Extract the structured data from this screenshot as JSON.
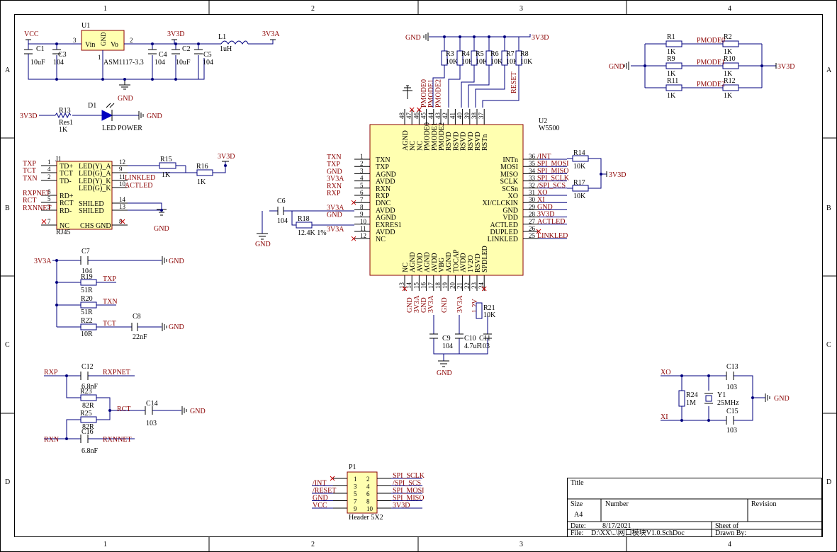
{
  "frame": {
    "cols": [
      "1",
      "2",
      "3",
      "4"
    ],
    "rows": [
      "A",
      "B",
      "C",
      "D"
    ]
  },
  "title_block": {
    "title_label": "Title",
    "size_label": "Size",
    "size_value": "A4",
    "number_label": "Number",
    "revision_label": "Revision",
    "date_label": "Date:",
    "date_value": "8/17/2021",
    "sheet_label": "Sheet  of",
    "file_label": "File:",
    "file_value": "D:\\XX\\..\\网口模块V1.0.SchDoc",
    "drawn_label": "Drawn By:"
  },
  "power": {
    "vcc": "VCC",
    "v33d": "3V3D",
    "v33a": "3V3A",
    "gnd": "GND"
  },
  "regulator": {
    "ref": "U1",
    "part": "ASM1117-3.3",
    "pin_vin": "Vin",
    "pin_vo": "Vo",
    "pin_gnd": "GND",
    "pin3": "3",
    "pin2": "2",
    "pin1": "1",
    "c1": "C1",
    "c1v": "10uF",
    "c3": "C3",
    "c3v": "104",
    "c4": "C4",
    "c4v": "104",
    "c2": "C2",
    "c2v": "10uF",
    "c5": "C5",
    "c5v": "104",
    "l1": "L1",
    "l1v": "1uH"
  },
  "led_circuit": {
    "r13": "R13",
    "r13v": "Res1",
    "r13k": "1K",
    "d1": "D1",
    "d1v": "LED  POWER"
  },
  "rj45": {
    "ref": "J1",
    "part": "RJ45",
    "left_pins": [
      {
        "num": "1",
        "name": "TD+",
        "net": "TXP"
      },
      {
        "num": "4",
        "name": "TCT",
        "net": "TCT"
      },
      {
        "num": "2",
        "name": "TD-",
        "net": "TXN"
      },
      {
        "num": "6",
        "name": "RD+",
        "net": "RXPNET"
      },
      {
        "num": "5",
        "name": "RCT",
        "net": "RCT"
      },
      {
        "num": "3",
        "name": "RD-",
        "net": "RXNNET"
      },
      {
        "num": "7",
        "name": "NC",
        "net": ""
      }
    ],
    "right_pins": [
      {
        "num": "12",
        "name": "LED(Y)_A"
      },
      {
        "num": "9",
        "name": "LED(G)_A"
      },
      {
        "num": "11",
        "name": "LED(Y)_K"
      },
      {
        "num": "10",
        "name": "LED(G)_K"
      },
      {
        "num": "14",
        "name": "SHILED"
      },
      {
        "num": "13",
        "name": "SHILED"
      },
      {
        "num": "8",
        "name": "CHS GND"
      }
    ],
    "r15": "R15",
    "r15v": "1K",
    "r16": "R16",
    "r16v": "1K",
    "linkled": "LINKLED",
    "actled": "ACTLED"
  },
  "w5500": {
    "ref": "U2",
    "part": "W5500",
    "left_pins": [
      {
        "num": "1",
        "name": "TXN",
        "net": "TXN"
      },
      {
        "num": "2",
        "name": "TXP",
        "net": "TXP"
      },
      {
        "num": "3",
        "name": "AGND",
        "net": "GND"
      },
      {
        "num": "4",
        "name": "AVDD",
        "net": "3V3A"
      },
      {
        "num": "5",
        "name": "RXN",
        "net": "RXN"
      },
      {
        "num": "6",
        "name": "RXP",
        "net": "RXP"
      },
      {
        "num": "7",
        "name": "DNC",
        "net": ""
      },
      {
        "num": "8",
        "name": "AVDD",
        "net": "3V3A"
      },
      {
        "num": "9",
        "name": "AGND",
        "net": "GND"
      },
      {
        "num": "10",
        "name": "EXRES1",
        "net": ""
      },
      {
        "num": "11",
        "name": "AVDD",
        "net": "3V3A"
      },
      {
        "num": "12",
        "name": "NC",
        "net": ""
      }
    ],
    "right_pins": [
      {
        "num": "36",
        "name": "INTn",
        "net": "/INT"
      },
      {
        "num": "35",
        "name": "MOSI",
        "net": "SPI_MOSI"
      },
      {
        "num": "34",
        "name": "MISO",
        "net": "SPI_MISO"
      },
      {
        "num": "33",
        "name": "SCLK",
        "net": "SPI_SCLK"
      },
      {
        "num": "32",
        "name": "SCSn",
        "net": "/SPI_SCS"
      },
      {
        "num": "31",
        "name": "XO",
        "net": "XO"
      },
      {
        "num": "30",
        "name": "XI/CLCKIN",
        "net": "XI"
      },
      {
        "num": "29",
        "name": "GND",
        "net": "GND"
      },
      {
        "num": "28",
        "name": "VDD",
        "net": "3V3D"
      },
      {
        "num": "27",
        "name": "ACTLED",
        "net": "ACTLED"
      },
      {
        "num": "26",
        "name": "DUPLED",
        "net": ""
      },
      {
        "num": "25",
        "name": "LINKLED",
        "net": "LINKLED"
      }
    ],
    "top_pins": [
      {
        "num": "48",
        "name": "AGND"
      },
      {
        "num": "47",
        "name": "NC"
      },
      {
        "num": "46",
        "name": "NC"
      },
      {
        "num": "45",
        "name": "PMODE0"
      },
      {
        "num": "44",
        "name": "PMODE1"
      },
      {
        "num": "43",
        "name": "PMODE2"
      },
      {
        "num": "42",
        "name": "RSVD"
      },
      {
        "num": "41",
        "name": "RSVD"
      },
      {
        "num": "40",
        "name": "RSVD"
      },
      {
        "num": "39",
        "name": "RSVD"
      },
      {
        "num": "38",
        "name": "RSVD"
      },
      {
        "num": "37",
        "name": "RSTn"
      }
    ],
    "top_nets": [
      "PMODE0",
      "PMODE1",
      "PMODE2"
    ],
    "bottom_pins": [
      {
        "num": "13",
        "name": "NC"
      },
      {
        "num": "14",
        "name": "AGND"
      },
      {
        "num": "15",
        "name": "AVDD"
      },
      {
        "num": "16",
        "name": "AGND"
      },
      {
        "num": "17",
        "name": "AVDD"
      },
      {
        "num": "18",
        "name": "VBG"
      },
      {
        "num": "19",
        "name": "AGND"
      },
      {
        "num": "20",
        "name": "TOCAP"
      },
      {
        "num": "21",
        "name": "AVDD"
      },
      {
        "num": "22",
        "name": "1V2O"
      },
      {
        "num": "23",
        "name": "RSVD"
      },
      {
        "num": "24",
        "name": "SPDLED"
      }
    ],
    "bottom_nets": [
      "GND",
      "3V3A",
      "GND",
      "3V3A",
      "GND",
      "3V3A",
      "1.2V"
    ],
    "reset_net": "RESET",
    "pullups": [
      "R3",
      "R4",
      "R5",
      "R6",
      "R7",
      "R8"
    ],
    "pullup_val": "10K",
    "c6": "C6",
    "c6v": "104",
    "r18": "R18",
    "r18v": "12.4K 1%",
    "r21": "R21",
    "r21v": "10K",
    "c9": "C9",
    "c9v": "104",
    "c10": "C10",
    "c10v": "4.7uF",
    "c11": "C11",
    "c11v": "103",
    "r14": "R14",
    "r14v": "10K",
    "r17": "R17",
    "r17v": "10K"
  },
  "pmode": {
    "rows": [
      {
        "ra": "R1",
        "rav": "1K",
        "net": "PMODE0",
        "rb": "R2",
        "rbv": "1K"
      },
      {
        "ra": "R9",
        "rav": "1K",
        "net": "PMODE1",
        "rb": "R10",
        "rbv": "1K"
      },
      {
        "ra": "R11",
        "rav": "1K",
        "net": "PMODE2",
        "rb": "R12",
        "rbv": "1K"
      }
    ]
  },
  "termination": {
    "c7": "C7",
    "c7v": "104",
    "r19": "R19",
    "r19v": "51R",
    "txp": "TXP",
    "r20": "R20",
    "r20v": "51R",
    "txn": "TXN",
    "r22": "R22",
    "r22v": "10R",
    "tct": "TCT",
    "c8": "C8",
    "c8v": "22nF"
  },
  "rx_filter": {
    "rxp": "RXP",
    "rxn": "RXN",
    "rxpnet": "RXPNET",
    "rxnnet": "RXNNET",
    "rct": "RCT",
    "c12": "C12",
    "c12v": "6.8nF",
    "r23": "R23",
    "r23v": "82R",
    "r25": "R25",
    "r25v": "82R",
    "c16": "C16",
    "c16v": "6.8nF",
    "c14": "C14",
    "c14v": "103"
  },
  "crystal": {
    "xo": "XO",
    "xi": "XI",
    "r24": "R24",
    "r24v": "1M",
    "y1": "Y1",
    "y1v": "25MHz",
    "c13": "C13",
    "c13v": "103",
    "c15": "C15",
    "c15v": "103"
  },
  "header": {
    "ref": "P1",
    "part": "Header 5X2",
    "left": [
      {
        "num": "1",
        "net": ""
      },
      {
        "num": "3",
        "net": "/INT"
      },
      {
        "num": "5",
        "net": "/RESET"
      },
      {
        "num": "7",
        "net": "GND"
      },
      {
        "num": "9",
        "net": "VCC"
      }
    ],
    "right": [
      {
        "num": "2",
        "net": "SPI_SCLK"
      },
      {
        "num": "4",
        "net": "/SPI_SCS"
      },
      {
        "num": "6",
        "net": "SPI_MOSI"
      },
      {
        "num": "8",
        "net": "SPI_MISO"
      },
      {
        "num": "10",
        "net": "3V3D"
      }
    ]
  }
}
